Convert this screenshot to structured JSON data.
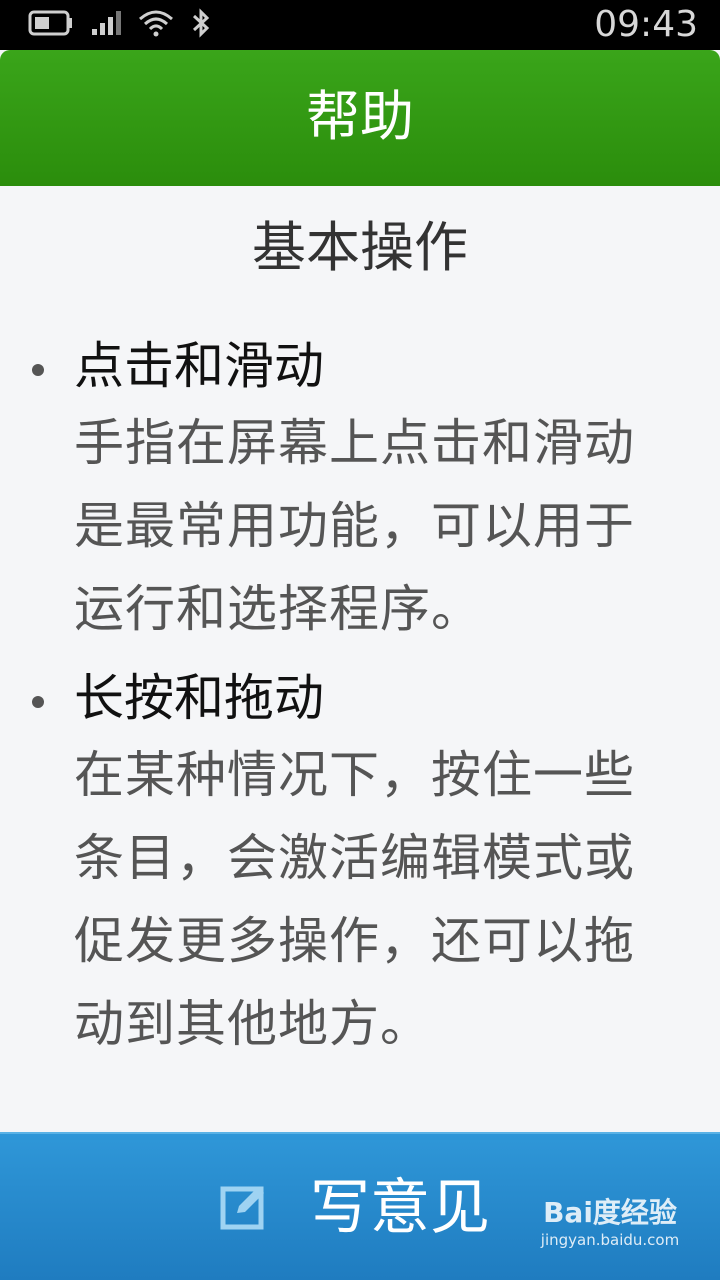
{
  "status_bar": {
    "time": "09:43",
    "icons": [
      "battery-icon",
      "signal-icon",
      "wifi-icon",
      "bluetooth-icon"
    ]
  },
  "header": {
    "title": "帮助"
  },
  "main": {
    "section_title": "基本操作",
    "items": [
      {
        "title": "点击和滑动",
        "description": "手指在屏幕上点击和滑动是最常用功能，可以用于运行和选择程序。"
      },
      {
        "title": "长按和拖动",
        "description": "在某种情况下，按住一些条目，会激活编辑模式或促发更多操作，还可以拖动到其他地方。"
      }
    ]
  },
  "footer": {
    "feedback_label": "写意见",
    "feedback_icon": "edit-icon"
  },
  "watermark": {
    "brand": "Bai度经验",
    "url": "jingyan.baidu.com"
  },
  "colors": {
    "header_green": "#2f9a12",
    "footer_blue": "#2688cc",
    "body_bg": "#f5f6f8",
    "desc_text": "#555555"
  }
}
